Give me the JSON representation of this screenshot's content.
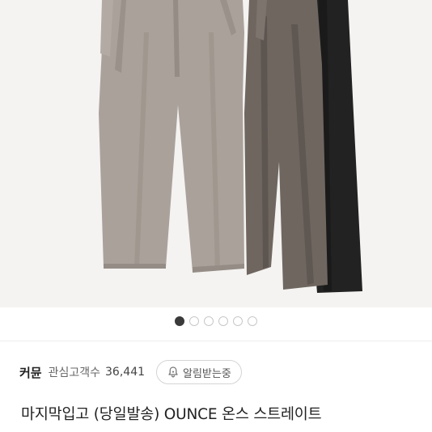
{
  "product_image": {
    "alt_icon": "trousers-photo",
    "colors": {
      "beige": "#a9a09a",
      "brown": "#6e645e",
      "black": "#252525",
      "background": "#f5f4f2"
    }
  },
  "carousel": {
    "total": 6,
    "active_index": 0,
    "active_color": "#3a3a3a"
  },
  "seller": {
    "name": "커뮨",
    "followers_label": "관심고객수",
    "followers_count": "36,441",
    "notify_label": "알림받는중",
    "notify_icon": "bell-icon"
  },
  "product": {
    "title": "마지막입고 (당일발송) OUNCE 온스 스트레이트"
  }
}
